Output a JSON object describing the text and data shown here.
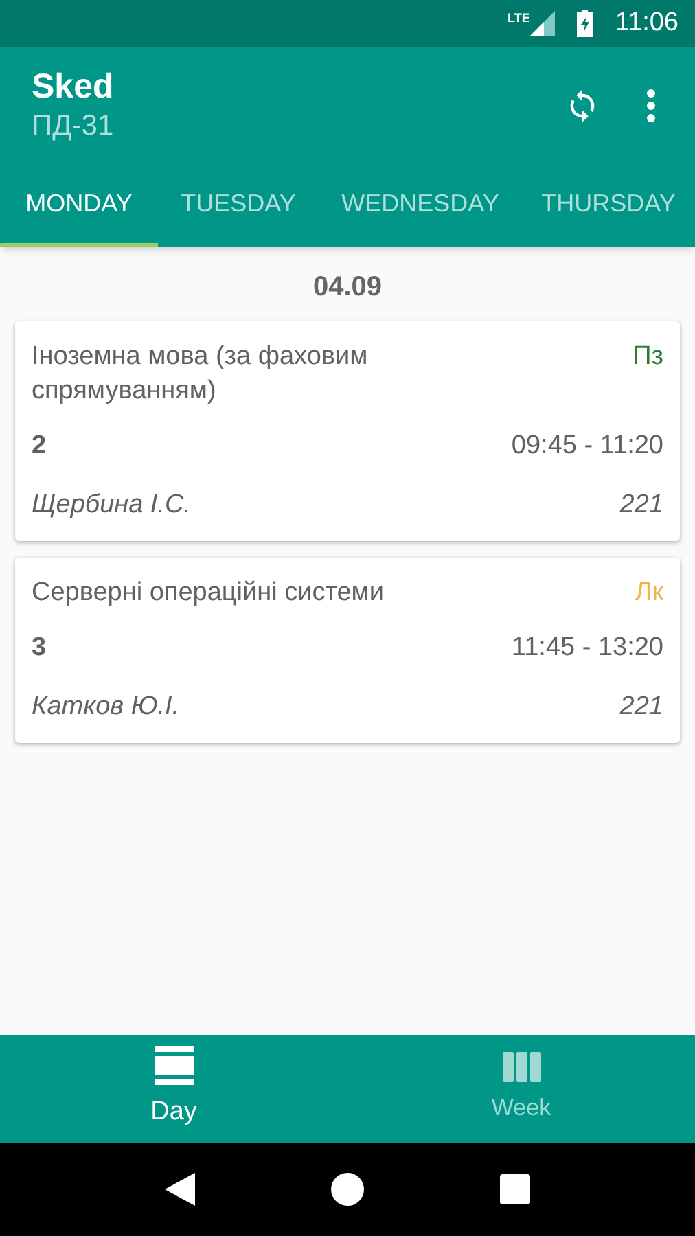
{
  "status_bar": {
    "network": "LTE",
    "time": "11:06"
  },
  "app_bar": {
    "title": "Sked",
    "subtitle": "ПД-31"
  },
  "tabs": [
    {
      "label": "MONDAY",
      "selected": true
    },
    {
      "label": "TUESDAY",
      "selected": false
    },
    {
      "label": "WEDNESDAY",
      "selected": false
    },
    {
      "label": "THURSDAY",
      "selected": false
    }
  ],
  "date": "04.09",
  "lessons": [
    {
      "subject": "Іноземна мова (за фаховим спрямуванням)",
      "type": "Пз",
      "color": "#2e7d32",
      "number": "2",
      "time": "09:45 - 11:20",
      "teacher": "Щербина І.С.",
      "room": "221"
    },
    {
      "subject": "Серверні операційні системи",
      "type": "Лк",
      "color": "#f6b04e",
      "number": "3",
      "time": "11:45 - 13:20",
      "teacher": "Катков Ю.І.",
      "room": "221"
    }
  ],
  "bottom_nav": [
    {
      "kind": "day",
      "label": "Day",
      "selected": true
    },
    {
      "kind": "week",
      "label": "Week",
      "selected": false
    }
  ]
}
